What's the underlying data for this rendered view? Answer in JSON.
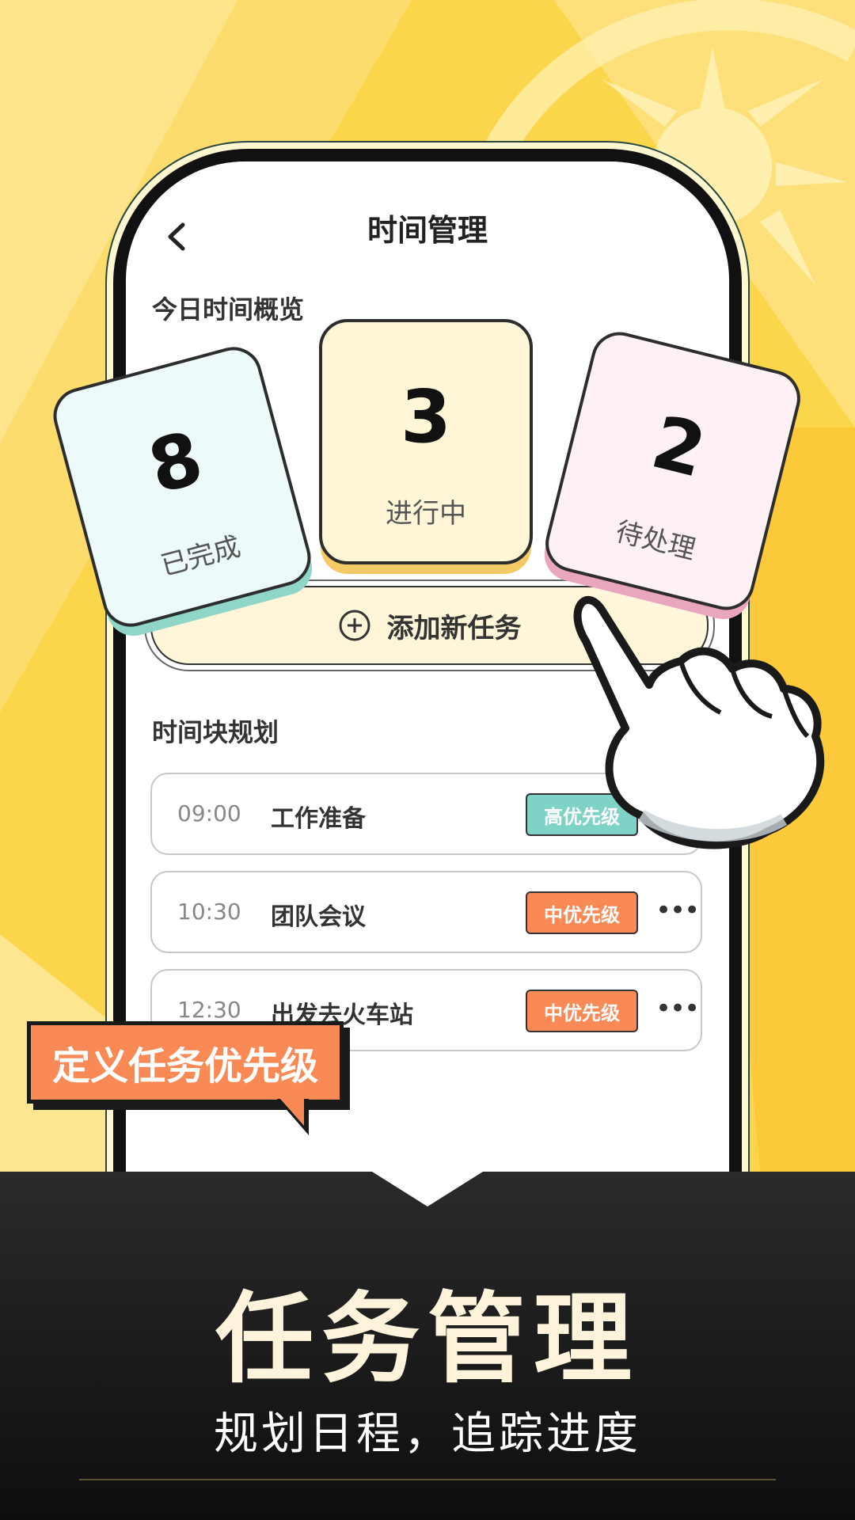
{
  "app": {
    "title": "时间管理",
    "back_icon": "chevron-left-icon"
  },
  "overview": {
    "title": "今日时间概览",
    "stats": [
      {
        "value": "8",
        "label": "已完成",
        "color": "#ecfbf9",
        "shade": "#8fd6c8"
      },
      {
        "value": "3",
        "label": "进行中",
        "color": "#fff6d8",
        "shade": "#f3ca66"
      },
      {
        "value": "2",
        "label": "待处理",
        "color": "#fdf1f4",
        "shade": "#eaa6bc"
      }
    ]
  },
  "add_task": {
    "label": "添加新任务",
    "icon": "plus-circle-icon"
  },
  "time_blocks": {
    "title": "时间块规划",
    "rows": [
      {
        "time": "09:00",
        "name": "工作准备",
        "priority": "高优先级",
        "priority_color": "#7fd3c6"
      },
      {
        "time": "10:30",
        "name": "团队会议",
        "priority": "中优先级",
        "priority_color": "#f98a55"
      },
      {
        "time": "12:30",
        "name": "出发去火车站",
        "priority": "中优先级",
        "priority_color": "#f98a55"
      }
    ]
  },
  "callout": {
    "text": "定义任务优先级"
  },
  "banner": {
    "title": "任务管理",
    "subtitle": "规划日程，追踪进度"
  },
  "colors": {
    "background": "#fbd54a",
    "accent_orange": "#f98a55",
    "accent_teal": "#7fd3c6"
  }
}
